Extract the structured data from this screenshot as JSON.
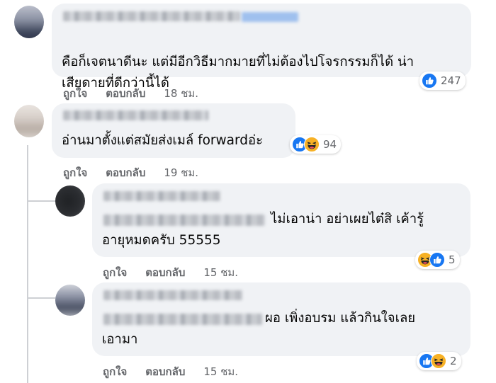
{
  "comments": [
    {
      "text_lines": [
        "คือก็เจตนาดีนะ แต่มีอีกวิธีมากมายที่ไม่ต้องไปโจรกรรมก็ได้ น่า",
        "เสียดายที่ดีกว่านี้ได้"
      ],
      "actions": {
        "like": "ถูกใจ",
        "reply": "ตอบกลับ",
        "time": "18 ชม."
      },
      "reactions": {
        "icons": [
          "like-icon"
        ],
        "count": "247"
      },
      "colors": {
        "avatar": "#5a6278"
      }
    },
    {
      "text_lines": [
        "อ่านมาตั้งแต่สมัยส่งเมล์ forwardอ่ะ"
      ],
      "actions": {
        "like": "ถูกใจ",
        "reply": "ตอบกลับ",
        "time": "19 ชม."
      },
      "reactions": {
        "icons": [
          "like-icon",
          "haha-icon"
        ],
        "count": "94"
      },
      "colors": {
        "avatar": "#c9c2bd"
      }
    },
    {
      "text_lines": [
        "ไม่เอาน่า อย่าเผยไต๋สิ เค้ารู้",
        "อายุหมดครับ 55555"
      ],
      "actions": {
        "like": "ถูกใจ",
        "reply": "ตอบกลับ",
        "time": "15 ชม."
      },
      "reactions": {
        "icons": [
          "haha-icon",
          "like-icon"
        ],
        "count": "5"
      },
      "colors": {
        "avatar": "#2b2d30"
      }
    },
    {
      "text_lines": [
        "ผอ เพิ่งอบรม แล้วกินใจเลย",
        "เอามา"
      ],
      "actions": {
        "like": "ถูกใจ",
        "reply": "ตอบกลับ",
        "time": "15 ชม."
      },
      "reactions": {
        "icons": [
          "like-icon",
          "haha-icon"
        ],
        "count": "2"
      },
      "colors": {
        "avatar": "#4d5466"
      }
    }
  ],
  "colors": {
    "like": "#1877f2",
    "haha": "#f7b125",
    "bubble": "#f0f2f5",
    "meta_text": "#65676b"
  }
}
